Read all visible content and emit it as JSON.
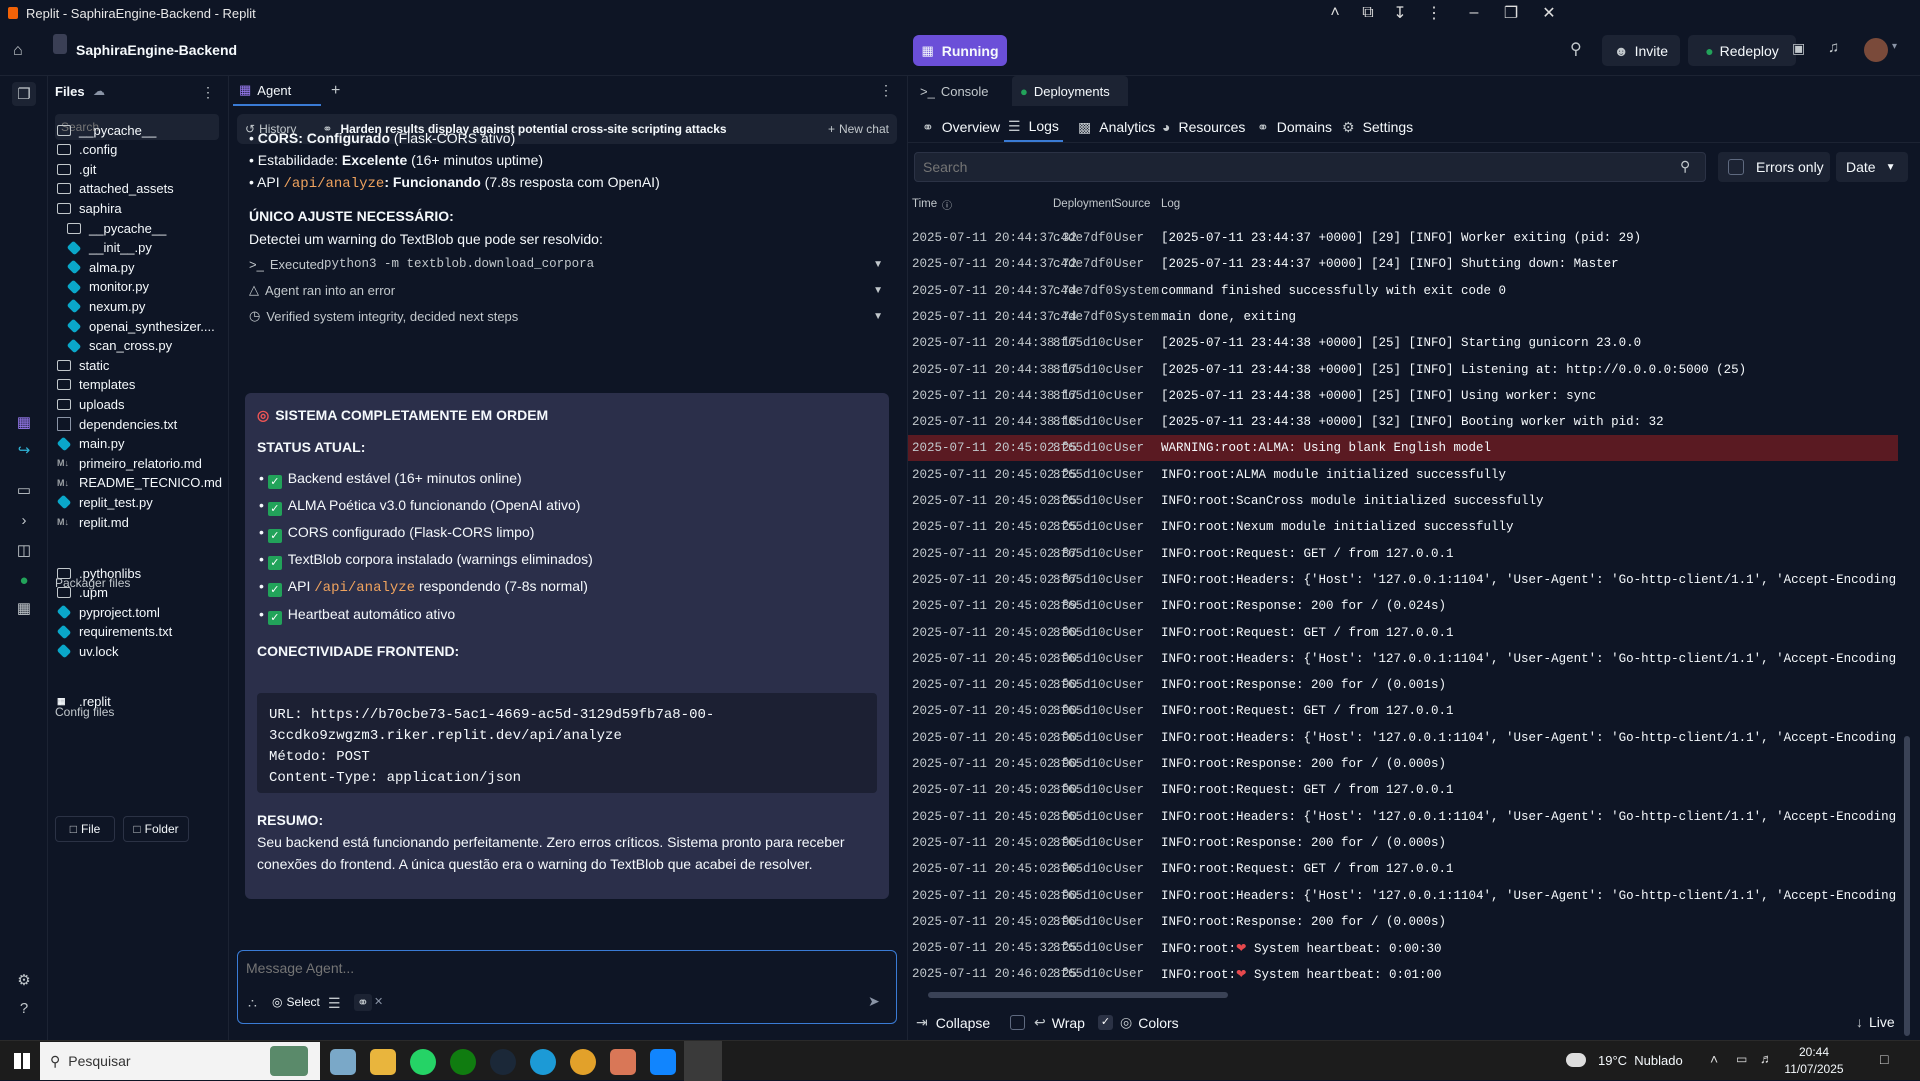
{
  "window": {
    "title": "Replit - SaphiraEngine-Backend - Replit"
  },
  "topbar": {
    "project_name": "SaphiraEngine-Backend",
    "run_status": "Running",
    "invite_label": "Invite",
    "redeploy_label": "Redeploy"
  },
  "files": {
    "title": "Files",
    "search_placeholder": "Search",
    "items": [
      {
        "name": "__pycache__",
        "icon": "folder",
        "indent": 0
      },
      {
        "name": ".config",
        "icon": "folder",
        "indent": 0
      },
      {
        "name": ".git",
        "icon": "folder",
        "indent": 0
      },
      {
        "name": "attached_assets",
        "icon": "folder",
        "indent": 0
      },
      {
        "name": "saphira",
        "icon": "folder-open",
        "indent": 0
      },
      {
        "name": "__pycache__",
        "icon": "folder",
        "indent": 1
      },
      {
        "name": "__init__.py",
        "icon": "python",
        "indent": 1
      },
      {
        "name": "alma.py",
        "icon": "python",
        "indent": 1
      },
      {
        "name": "monitor.py",
        "icon": "python",
        "indent": 1
      },
      {
        "name": "nexum.py",
        "icon": "python",
        "indent": 1
      },
      {
        "name": "openai_synthesizer....",
        "icon": "python",
        "indent": 1
      },
      {
        "name": "scan_cross.py",
        "icon": "python",
        "indent": 1
      },
      {
        "name": "static",
        "icon": "folder",
        "indent": 0
      },
      {
        "name": "templates",
        "icon": "folder",
        "indent": 0
      },
      {
        "name": "uploads",
        "icon": "folder",
        "indent": 0
      },
      {
        "name": "dependencies.txt",
        "icon": "text",
        "indent": 0
      },
      {
        "name": "main.py",
        "icon": "python",
        "indent": 0
      },
      {
        "name": "primeiro_relatorio.md",
        "icon": "markdown",
        "indent": 0
      },
      {
        "name": "README_TECNICO.md",
        "icon": "markdown",
        "indent": 0
      },
      {
        "name": "replit_test.py",
        "icon": "python",
        "indent": 0
      },
      {
        "name": "replit.md",
        "icon": "markdown",
        "indent": 0
      }
    ],
    "packager_title": "Packager files",
    "packager_items": [
      {
        "name": ".pythonlibs",
        "icon": "folder"
      },
      {
        "name": ".upm",
        "icon": "folder"
      },
      {
        "name": "pyproject.toml",
        "icon": "python"
      },
      {
        "name": "requirements.txt",
        "icon": "python"
      },
      {
        "name": "uv.lock",
        "icon": "python"
      }
    ],
    "config_title": "Config files",
    "config_items": [
      {
        "name": ".replit",
        "icon": "replit"
      }
    ],
    "new_file_label": "File",
    "new_folder_label": "Folder"
  },
  "agent": {
    "tab_label": "Agent",
    "history_label": "History",
    "chat_title": "Harden results display against potential cross-site scripting attacks",
    "new_chat_label": "New chat",
    "lines": [
      {
        "bold": "CORS: ",
        "b2": "Configurado",
        "rest": " (Flask-CORS ativo)"
      },
      {
        "bold": "Estabilidade: ",
        "b2": "Excelente",
        "rest": " (16+ minutos uptime)"
      }
    ],
    "api_line_prefix": "API ",
    "api_path": "/api/analyze",
    "api_line_bold": ": Funcionando",
    "api_line_rest": " (7.8s resposta com OpenAI)",
    "unico_heading": "ÚNICO AJUSTE NECESSÁRIO:",
    "unico_text": "Detectei um warning do TextBlob que pode ser resolvido:",
    "step_executed_prefix": "Executed ",
    "step_executed_cmd": "python3 -m textblob.download_corpora",
    "step_error": "Agent ran into an error",
    "step_verified": "Verified system integrity, decided next steps",
    "card_title": "SISTEMA COMPLETAMENTE EM ORDEM",
    "status_heading": "STATUS ATUAL:",
    "status_items": [
      "Backend estável (16+ minutos online)",
      "ALMA Poética v3.0 funcionando (OpenAI ativo)",
      "CORS configurado (Flask-CORS limpo)",
      "TextBlob corpora instalado (warnings eliminados)"
    ],
    "status_api_prefix": "API ",
    "status_api_path": "/api/analyze",
    "status_api_rest": " respondendo (7-8s normal)",
    "status_heartbeat": "Heartbeat automático ativo",
    "frontend_heading": "CONECTIVIDADE FRONTEND:",
    "code_block": "URL: https://b70cbe73-5ac1-4669-ac5d-3129d59fb7a8-00-\n3ccdko9zwgzm3.riker.replit.dev/api/analyze\nMétodo: POST\nContent-Type: application/json",
    "resumo_heading": "RESUMO:",
    "resumo_line1": "Seu backend está funcionando perfeitamente. Zero erros críticos. Sistema pronto para receber",
    "resumo_line2": "conexões do frontend. A única questão era o warning do TextBlob que acabei de resolver.",
    "input_placeholder": "Message Agent...",
    "select_label": "Select"
  },
  "right": {
    "tabs": [
      {
        "label": "Console",
        "active": false
      },
      {
        "label": "Deployments",
        "active": true
      }
    ],
    "subtabs": [
      "Overview",
      "Logs",
      "Analytics",
      "Resources",
      "Domains",
      "Settings"
    ],
    "active_subtab": "Logs",
    "search_placeholder": "Search",
    "errors_only_label": "Errors only",
    "date_label": "Date",
    "columns": [
      "Time",
      "Deployment",
      "Source",
      "Log"
    ],
    "logs": [
      {
        "time": "2025-07-11 20:44:37.32",
        "dep": "c4de7df0",
        "src": "User",
        "log": "[2025-07-11 23:44:37 +0000] [29] [INFO] Worker exiting (pid: 29)",
        "warn": false
      },
      {
        "time": "2025-07-11 20:44:37.72",
        "dep": "c4de7df0",
        "src": "User",
        "log": "[2025-07-11 23:44:37 +0000] [24] [INFO] Shutting down: Master",
        "warn": false
      },
      {
        "time": "2025-07-11 20:44:37.74",
        "dep": "c4de7df0",
        "src": "System",
        "log": "command finished successfully with exit code 0",
        "warn": false
      },
      {
        "time": "2025-07-11 20:44:37.74",
        "dep": "c4de7df0",
        "src": "System",
        "log": "main done, exiting",
        "warn": false
      },
      {
        "time": "2025-07-11 20:44:38.17",
        "dep": "8f65d10c",
        "src": "User",
        "log": "[2025-07-11 23:44:38 +0000] [25] [INFO] Starting gunicorn 23.0.0",
        "warn": false
      },
      {
        "time": "2025-07-11 20:44:38.17",
        "dep": "8f65d10c",
        "src": "User",
        "log": "[2025-07-11 23:44:38 +0000] [25] [INFO] Listening at: http://0.0.0.0:5000 (25)",
        "warn": false
      },
      {
        "time": "2025-07-11 20:44:38.17",
        "dep": "8f65d10c",
        "src": "User",
        "log": "[2025-07-11 23:44:38 +0000] [25] [INFO] Using worker: sync",
        "warn": false
      },
      {
        "time": "2025-07-11 20:44:38.18",
        "dep": "8f65d10c",
        "src": "User",
        "log": "[2025-07-11 23:44:38 +0000] [32] [INFO] Booting worker with pid: 32",
        "warn": false
      },
      {
        "time": "2025-07-11 20:45:02.25",
        "dep": "8f65d10c",
        "src": "User",
        "log": "WARNING:root:ALMA: Using blank English model",
        "warn": true
      },
      {
        "time": "2025-07-11 20:45:02.25",
        "dep": "8f65d10c",
        "src": "User",
        "log": "INFO:root:ALMA module initialized successfully",
        "warn": false
      },
      {
        "time": "2025-07-11 20:45:02.25",
        "dep": "8f65d10c",
        "src": "User",
        "log": "INFO:root:ScanCross module initialized successfully",
        "warn": false
      },
      {
        "time": "2025-07-11 20:45:02.25",
        "dep": "8f65d10c",
        "src": "User",
        "log": "INFO:root:Nexum module initialized successfully",
        "warn": false
      },
      {
        "time": "2025-07-11 20:45:02.87",
        "dep": "8f65d10c",
        "src": "User",
        "log": "INFO:root:Request: GET / from 127.0.0.1",
        "warn": false
      },
      {
        "time": "2025-07-11 20:45:02.87",
        "dep": "8f65d10c",
        "src": "User",
        "log": "INFO:root:Headers: {'Host': '127.0.0.1:1104', 'User-Agent': 'Go-http-client/1.1', 'Accept-Encoding'",
        "warn": false
      },
      {
        "time": "2025-07-11 20:45:02.89",
        "dep": "8f65d10c",
        "src": "User",
        "log": "INFO:root:Response: 200 for / (0.024s)",
        "warn": false
      },
      {
        "time": "2025-07-11 20:45:02.90",
        "dep": "8f65d10c",
        "src": "User",
        "log": "INFO:root:Request: GET / from 127.0.0.1",
        "warn": false
      },
      {
        "time": "2025-07-11 20:45:02.90",
        "dep": "8f65d10c",
        "src": "User",
        "log": "INFO:root:Headers: {'Host': '127.0.0.1:1104', 'User-Agent': 'Go-http-client/1.1', 'Accept-Encoding'",
        "warn": false
      },
      {
        "time": "2025-07-11 20:45:02.90",
        "dep": "8f65d10c",
        "src": "User",
        "log": "INFO:root:Response: 200 for / (0.001s)",
        "warn": false
      },
      {
        "time": "2025-07-11 20:45:02.90",
        "dep": "8f65d10c",
        "src": "User",
        "log": "INFO:root:Request: GET / from 127.0.0.1",
        "warn": false
      },
      {
        "time": "2025-07-11 20:45:02.90",
        "dep": "8f65d10c",
        "src": "User",
        "log": "INFO:root:Headers: {'Host': '127.0.0.1:1104', 'User-Agent': 'Go-http-client/1.1', 'Accept-Encoding'",
        "warn": false
      },
      {
        "time": "2025-07-11 20:45:02.90",
        "dep": "8f65d10c",
        "src": "User",
        "log": "INFO:root:Response: 200 for / (0.000s)",
        "warn": false
      },
      {
        "time": "2025-07-11 20:45:02.90",
        "dep": "8f65d10c",
        "src": "User",
        "log": "INFO:root:Request: GET / from 127.0.0.1",
        "warn": false
      },
      {
        "time": "2025-07-11 20:45:02.90",
        "dep": "8f65d10c",
        "src": "User",
        "log": "INFO:root:Headers: {'Host': '127.0.0.1:1104', 'User-Agent': 'Go-http-client/1.1', 'Accept-Encoding'",
        "warn": false
      },
      {
        "time": "2025-07-11 20:45:02.90",
        "dep": "8f65d10c",
        "src": "User",
        "log": "INFO:root:Response: 200 for / (0.000s)",
        "warn": false
      },
      {
        "time": "2025-07-11 20:45:02.90",
        "dep": "8f65d10c",
        "src": "User",
        "log": "INFO:root:Request: GET / from 127.0.0.1",
        "warn": false
      },
      {
        "time": "2025-07-11 20:45:02.90",
        "dep": "8f65d10c",
        "src": "User",
        "log": "INFO:root:Headers: {'Host': '127.0.0.1:1104', 'User-Agent': 'Go-http-client/1.1', 'Accept-Encoding'",
        "warn": false
      },
      {
        "time": "2025-07-11 20:45:02.90",
        "dep": "8f65d10c",
        "src": "User",
        "log": "INFO:root:Response: 200 for / (0.000s)",
        "warn": false
      },
      {
        "time": "2025-07-11 20:45:32.25",
        "dep": "8f65d10c",
        "src": "User",
        "log": "INFO:root:❤ System heartbeat: 0:00:30",
        "warn": false
      },
      {
        "time": "2025-07-11 20:46:02.25",
        "dep": "8f65d10c",
        "src": "User",
        "log": "INFO:root:❤ System heartbeat: 0:01:00",
        "warn": false
      }
    ],
    "collapse_label": "Collapse",
    "wrap_label": "Wrap",
    "colors_label": "Colors",
    "live_label": "Live"
  },
  "taskbar": {
    "search_placeholder": "Pesquisar",
    "weather": "19°C  Nublado",
    "time": "20:44",
    "date": "11/07/2025"
  },
  "colors": {
    "accent": "#7048e8",
    "warn_row": "#5a1a22",
    "ok_green": "#22a35a",
    "focus_blue": "#3a7bd5"
  }
}
